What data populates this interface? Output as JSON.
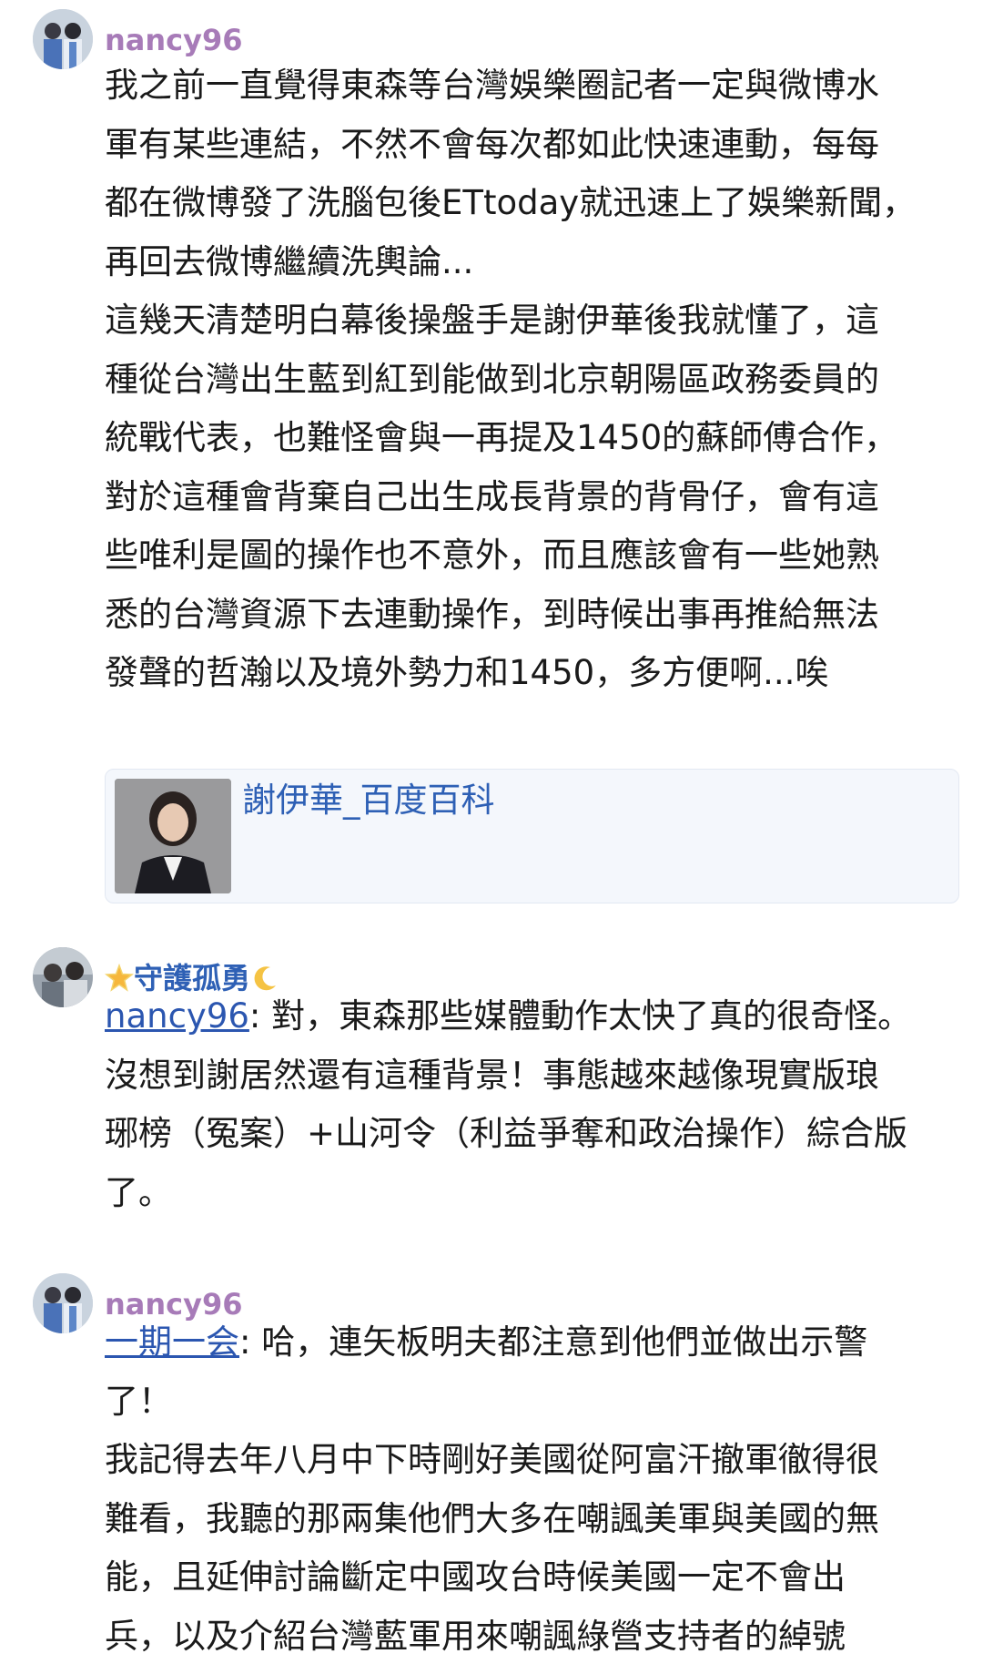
{
  "posts": [
    {
      "username": "nancy96",
      "paragraphs": [
        [
          "我之前一直覺得東森等台灣娛樂圈記者一定與微博水",
          "軍有某些連結，不然不會每次都如此快速連動，每每",
          "都在微博發了洗腦包後ETtoday就迅速上了娛樂新聞，",
          "再回去微博繼續洗輿論..."
        ],
        [
          "這幾天清楚明白幕後操盤手是謝伊華後我就懂了，這",
          "種從台灣出生藍到紅到能做到北京朝陽區政務委員的",
          "統戰代表，也難怪會與一再提及1450的蘇師傅合作，",
          "對於這種會背棄自己出生成長背景的背骨仔，會有這",
          "些唯利是圖的操作也不意外，而且應該會有一些她熟",
          "悉的台灣資源下去連動操作，到時候出事再推給無法",
          "發聲的哲瀚以及境外勢力和1450，多方便啊...唉"
        ]
      ],
      "link_card": {
        "title": "謝伊華_百度百科",
        "thumbnail_icon": "person-photo"
      }
    },
    {
      "username": "守護孤勇",
      "username_prefix_icon": "glowing-star-icon",
      "username_suffix_icon": "crescent-moon-icon",
      "mention": "nancy96",
      "lines": [
        ": 對，東森那些媒體動作太快了真的很奇怪。",
        "沒想到謝居然還有這種背景！事態越來越像現實版琅",
        "琊榜（冤案）+山河令（利益爭奪和政治操作）綜合版",
        "了。"
      ]
    },
    {
      "username": "nancy96",
      "mention": "一期一会",
      "lines": [
        ": 哈，連矢板明夫都注意到他們並做出示警",
        "了！"
      ],
      "paragraph2": [
        "我記得去年八月中下時剛好美國從阿富汗撤軍徹得很",
        "難看，我聽的那兩集他們大多在嘲諷美軍與美國的無",
        "能，且延伸討論斷定中國攻台時候美國一定不會出",
        "兵，以及介紹台灣藍軍用來嘲諷綠營支持者的綽號"
      ]
    }
  ],
  "colors": {
    "username_purple": "#a77bb8",
    "username_blue": "#2e60b5",
    "link": "#2b56b0",
    "text": "#1a1a1a",
    "card_bg": "#f4f7fc"
  }
}
